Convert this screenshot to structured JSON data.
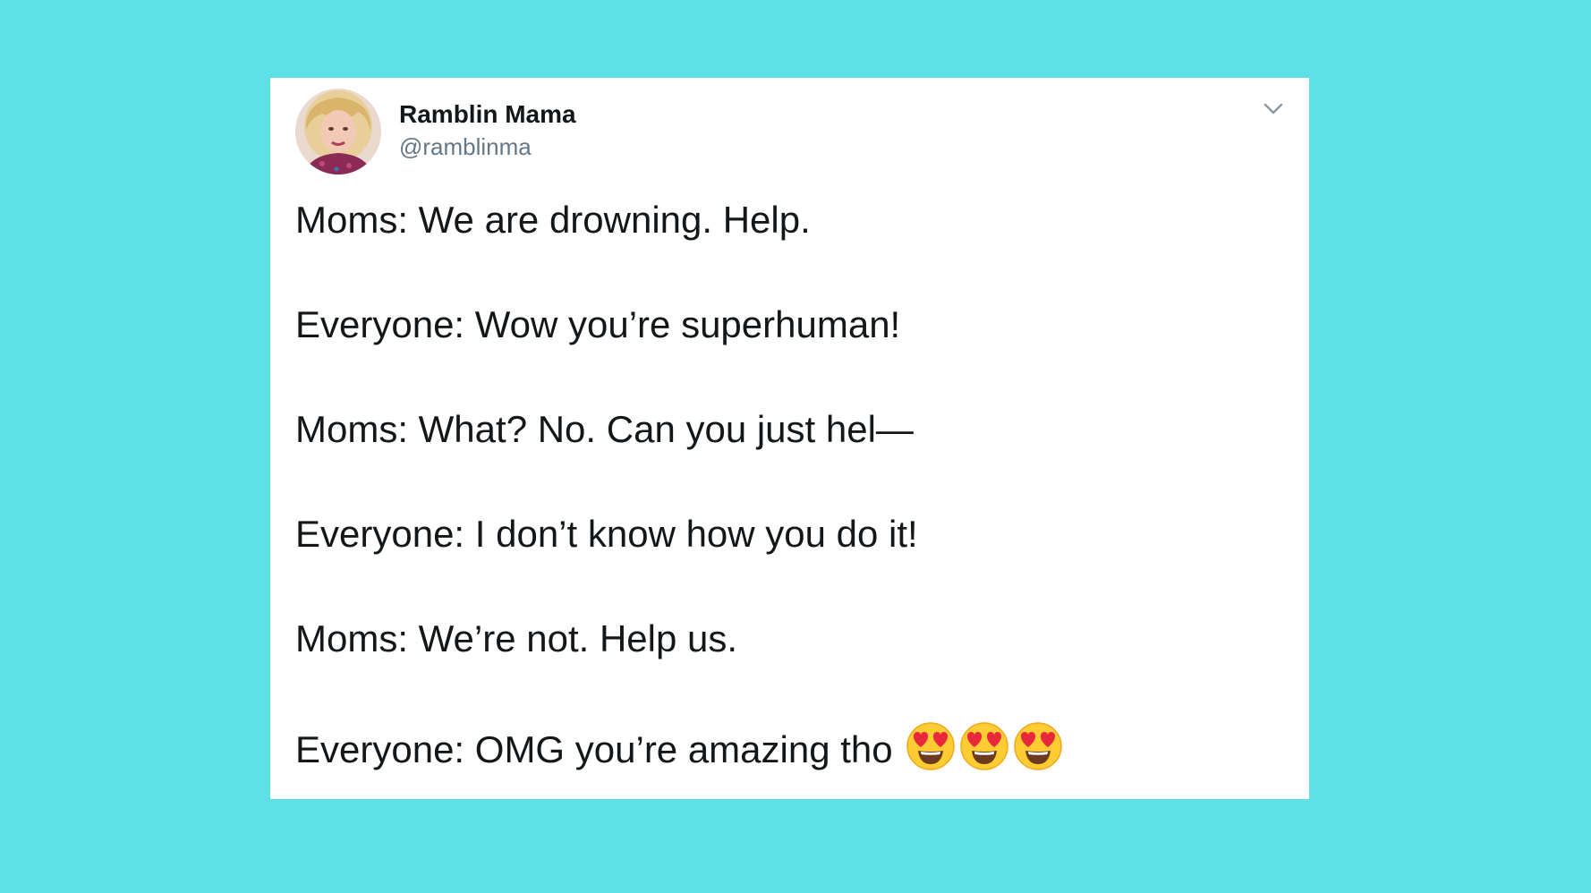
{
  "tweet": {
    "author": {
      "name": "Ramblin Mama",
      "handle": "@ramblinma",
      "avatar_icon": "profile-photo-avatar"
    },
    "menu_icon": "chevron-down-icon",
    "lines": [
      "Moms: We are drowning. Help.",
      "Everyone: Wow you’re superhuman!",
      "Moms: What? No. Can you just hel—",
      "Everyone: I don’t know how you do it!",
      "Moms: We’re not. Help us.",
      "Everyone: OMG you’re amazing tho"
    ],
    "trailing_emoji": {
      "icon": "heart-eyes-emoji",
      "count": 3
    }
  },
  "colors": {
    "background": "#5de0e6",
    "card": "#ffffff",
    "text": "#14171a",
    "handle": "#657786"
  }
}
